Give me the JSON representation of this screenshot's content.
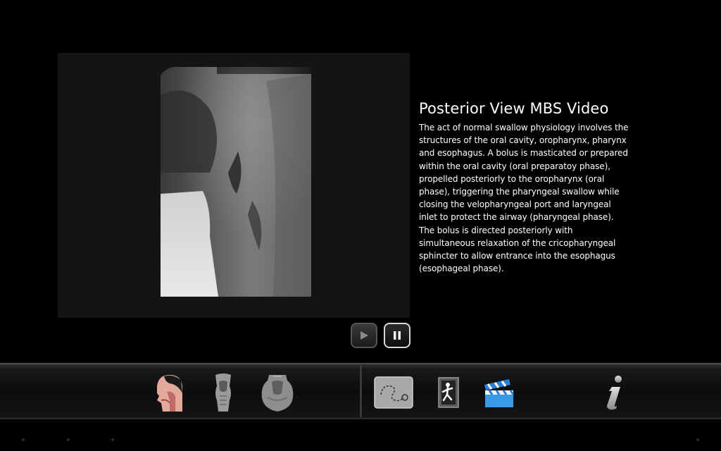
{
  "video": {
    "title": "Posterior View MBS Video",
    "description": "The act of normal swallow physiology involves the structures of the oral cavity, oropharynx, pharynx and esophagus.  A bolus is masticated or prepared within the oral cavity (oral preparatoy phase), propelled posteriorly to the oropharynx (oral phase), triggering the pharyngeal swallow while closing the velopharyngeal port and laryngeal inlet to protect the airway (pharyngeal phase). The bolus is directed posteriorly with simultaneous relaxation of the cricopharyngeal sphincter to allow entrance into the esophagus (esophageal phase)."
  },
  "controls": {
    "play_icon": "play-icon",
    "pause_icon": "pause-icon"
  },
  "toolbar": {
    "left_tools": [
      "head-anatomy-icon",
      "larynx-front-icon",
      "larynx-back-icon"
    ],
    "right_tools": [
      "swallow-path-icon",
      "exit-door-icon",
      "video-clapper-icon",
      "info-icon"
    ]
  }
}
